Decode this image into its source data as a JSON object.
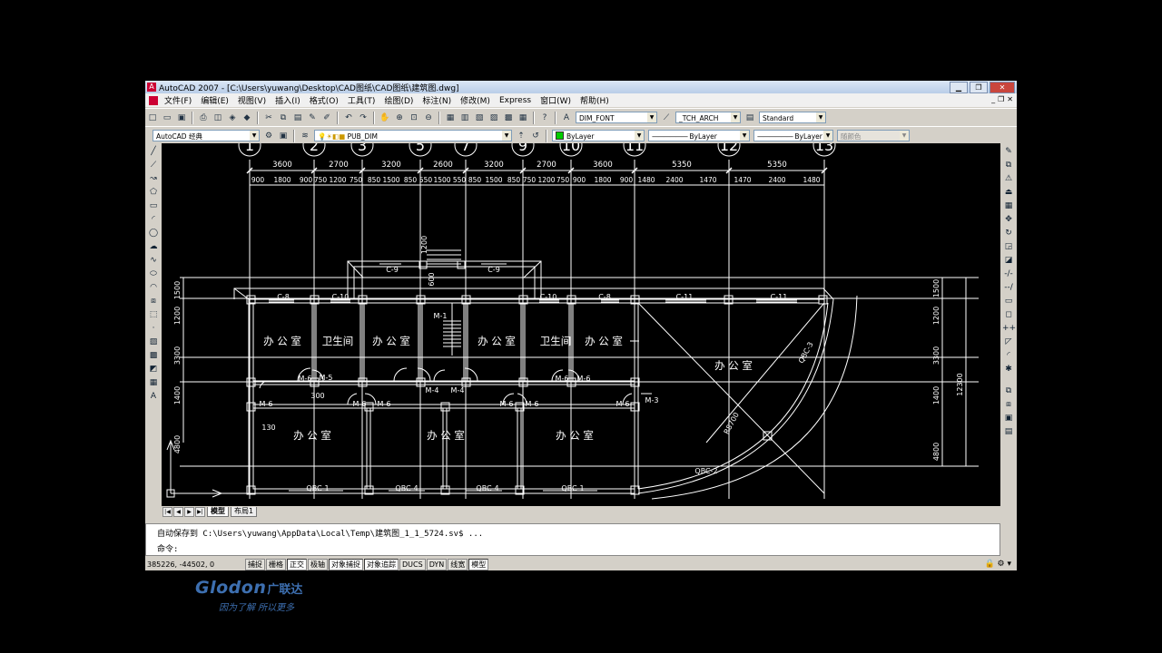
{
  "window": {
    "title": "AutoCAD 2007 - [C:\\Users\\yuwang\\Desktop\\CAD图纸\\CAD图纸\\建筑图.dwg]",
    "min": "▁",
    "max": "❐",
    "close": "✕"
  },
  "menu": [
    "文件(F)",
    "编辑(E)",
    "视图(V)",
    "插入(I)",
    "格式(O)",
    "工具(T)",
    "绘图(D)",
    "标注(N)",
    "修改(M)",
    "Express",
    "窗口(W)",
    "帮助(H)"
  ],
  "toolbar": {
    "textstyle": "DIM_FONT",
    "dimstyle": "_TCH_ARCH",
    "tablestyle": "Standard",
    "workspace": "AutoCAD 经典",
    "layer": "PUB_DIM",
    "color": "ByLayer",
    "linetype": "ByLayer",
    "lineweight": "ByLayer",
    "plotstyle": "随颜色"
  },
  "tabs": {
    "model": "模型",
    "layout": "布局1"
  },
  "command": {
    "history": "自动保存到 C:\\Users\\yuwang\\AppData\\Local\\Temp\\建筑图_1_1_5724.sv$ ...",
    "prompt": "命令:"
  },
  "status": {
    "coords": "385226, -44502, 0",
    "buttons": [
      "捕捉",
      "栅格",
      "正交",
      "极轴",
      "对象捕捉",
      "对象追踪",
      "DUCS",
      "DYN",
      "线宽",
      "模型"
    ]
  },
  "drawing": {
    "axis_labels": [
      "1",
      "2",
      "3",
      "5",
      "7",
      "9",
      "10",
      "11",
      "12",
      "13"
    ],
    "dims_top": [
      "3600",
      "2700",
      "3200",
      "2600",
      "3200",
      "2700",
      "3600",
      "5350",
      "5350"
    ],
    "dims_sub": [
      "900",
      "1800",
      "900",
      "750",
      "1200",
      "750",
      "850",
      "1500",
      "850",
      "550",
      "1500",
      "550",
      "850",
      "1500",
      "850",
      "750",
      "1200",
      "750",
      "900",
      "1800",
      "900",
      "1480",
      "2400",
      "1470",
      "1470",
      "2400",
      "1480"
    ],
    "dims_right": [
      "1500",
      "1200",
      "3300",
      "1400",
      "4800"
    ],
    "dim_right_total": "12300",
    "dims_left": [
      "1500",
      "1200",
      "3300",
      "1400",
      "4800"
    ],
    "rooms": [
      "办 公 室",
      "卫生间",
      "办 公 室",
      "办 公 室",
      "卫生间",
      "办 公 室",
      "办 公 室",
      "办 公 室",
      "办 公 室",
      "办 公 室"
    ],
    "tags": {
      "c9a": "C-9",
      "c9b": "C-9",
      "c8a": "C-8",
      "c10a": "C-10",
      "c10b": "C-10",
      "c8b": "C-8",
      "c11a": "C-11",
      "c11b": "C-11",
      "m1": "M-1",
      "m6": "M-6",
      "m5": "M-5",
      "m3": "M-3",
      "m4": "M-4",
      "qbc1": "QBC-1",
      "qbc4": "QBC-4",
      "qbc2": "QBC-2",
      "qbc3": "QBC-3",
      "r": "R8700",
      "s300": "300",
      "s130": "130",
      "s600": "600",
      "s1200": "1200"
    }
  },
  "logo": {
    "brand": "Glodon",
    "cn": "广联达",
    "slogan": "因为了解  所以更多"
  }
}
